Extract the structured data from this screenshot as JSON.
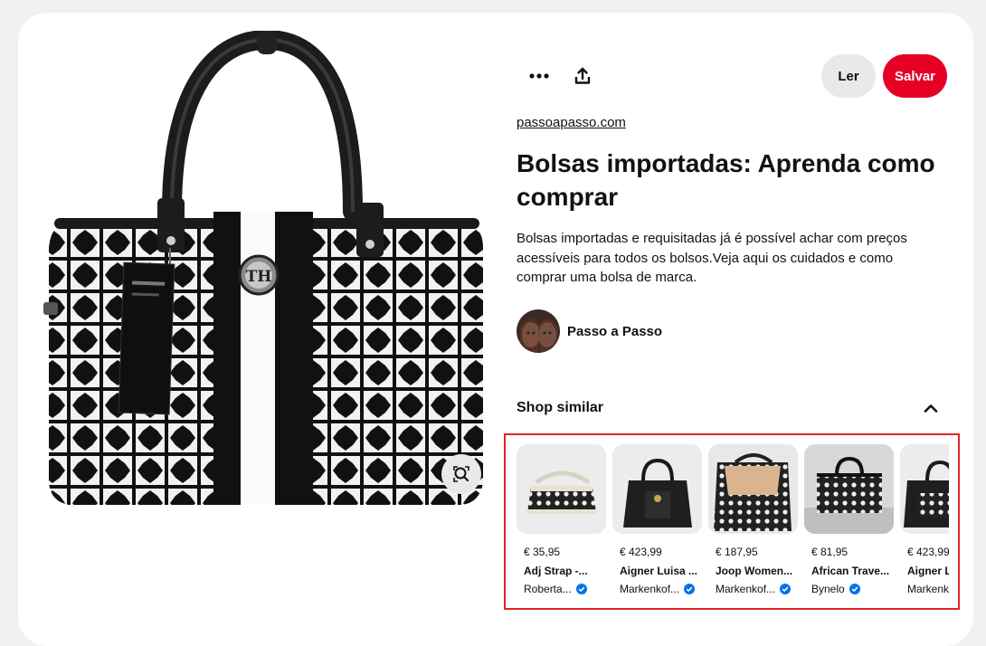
{
  "pin": {
    "image_alt": "Bolsa preta e branca com estampa geométrica",
    "logo_letters": "TH"
  },
  "toolbar": {
    "more_icon": "more-dots-icon",
    "share_icon": "share-icon",
    "read_label": "Ler",
    "save_label": "Salvar"
  },
  "details": {
    "source": "passoapasso.com",
    "title": "Bolsas importadas: Aprenda como comprar",
    "description": "Bolsas importadas e requisitadas já é possível achar com preços acessíveis para todos os bolsos.Veja aqui os cuidados e como comprar uma bolsa de marca.",
    "creator": "Passo a Passo"
  },
  "shop": {
    "title": "Shop similar",
    "products": [
      {
        "price": "€ 35,95",
        "name": "Adj Strap -...",
        "merchant": "Roberta...",
        "verified": true
      },
      {
        "price": "€ 423,99",
        "name": "Aigner Luisa ...",
        "merchant": "Markenkof...",
        "verified": true
      },
      {
        "price": "€ 187,95",
        "name": "Joop Women...",
        "merchant": "Markenkof...",
        "verified": true
      },
      {
        "price": "€ 81,95",
        "name": "African Trave...",
        "merchant": "Bynelo",
        "verified": true
      },
      {
        "price": "€ 423,99",
        "name": "Aigner L",
        "merchant": "Markenk",
        "verified": false
      }
    ]
  },
  "colors": {
    "save": "#e60023",
    "verified": "#0074e8",
    "highlight": "#e02424"
  }
}
